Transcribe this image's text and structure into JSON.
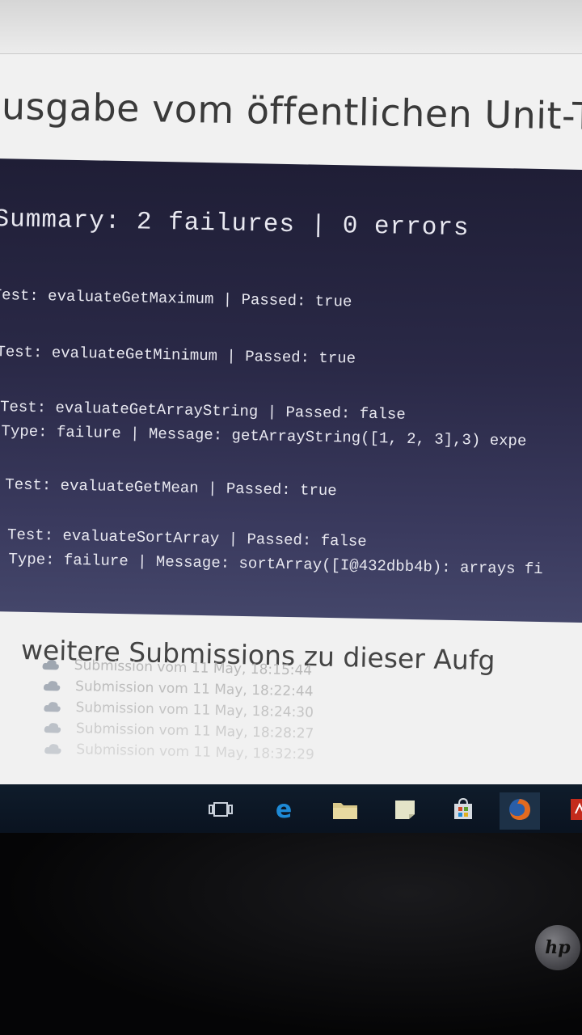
{
  "page": {
    "heading": "usgabe vom öffentlichen Unit-T"
  },
  "console": {
    "summary": "Summary: 2 failures | 0 errors",
    "lines": [
      "Test: evaluateGetMaximum | Passed: true",
      "Test: evaluateGetMinimum | Passed: true",
      "Test: evaluateGetArrayString | Passed: false",
      "Type: failure | Message: getArrayString([1, 2, 3],3) expe",
      "Test: evaluateGetMean | Passed: true",
      "Test: evaluateSortArray | Passed: false",
      "Type: failure | Message: sortArray([I@432dbb4b): arrays fi"
    ]
  },
  "submissions": {
    "heading": "weitere Submissions zu dieser Aufg",
    "items": [
      "Submission vom 11 May, 18:15:44",
      "Submission vom 11 May, 18:22:44",
      "Submission vom 11 May, 18:24:30",
      "Submission vom 11 May, 18:28:27",
      "Submission vom 11 May, 18:32:29"
    ]
  },
  "taskbar": {
    "icons": [
      "task-view-icon",
      "edge-icon",
      "file-explorer-icon",
      "notes-icon",
      "store-icon",
      "firefox-icon",
      "pdf-icon"
    ]
  },
  "colors": {
    "console_bg": "#2a2947",
    "console_text": "#e8e8f0",
    "taskbar_bg": "#0f1c2b",
    "edge_blue": "#1e8ad6"
  },
  "brand": {
    "logo": "hp"
  }
}
